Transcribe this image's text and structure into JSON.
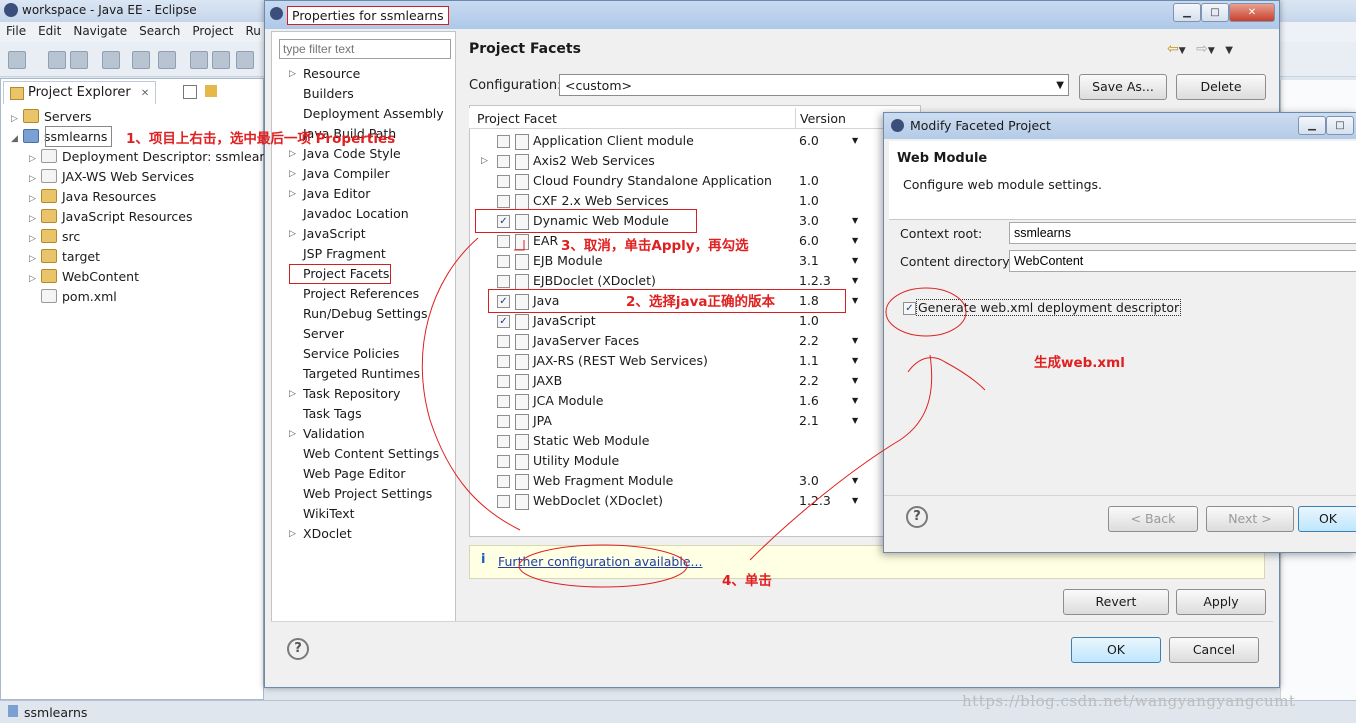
{
  "eclipse": {
    "window_title": "workspace - Java EE - Eclipse",
    "menu": [
      "File",
      "Edit",
      "Navigate",
      "Search",
      "Project",
      "Ru"
    ],
    "explorer_tab": "Project Explorer",
    "tree": [
      {
        "label": "Servers",
        "arrow": "▷",
        "indent": 0,
        "icon": "folder"
      },
      {
        "label": "ssmlearns",
        "arrow": "◢",
        "indent": 0,
        "icon": "project"
      },
      {
        "label": "Deployment Descriptor: ssmlearn",
        "arrow": "▷",
        "indent": 1,
        "icon": "doc"
      },
      {
        "label": "JAX-WS Web Services",
        "arrow": "▷",
        "indent": 1,
        "icon": "doc"
      },
      {
        "label": "Java Resources",
        "arrow": "▷",
        "indent": 1,
        "icon": "folder"
      },
      {
        "label": "JavaScript Resources",
        "arrow": "▷",
        "indent": 1,
        "icon": "folder"
      },
      {
        "label": "src",
        "arrow": "▷",
        "indent": 1,
        "icon": "folder"
      },
      {
        "label": "target",
        "arrow": "▷",
        "indent": 1,
        "icon": "folder"
      },
      {
        "label": "WebContent",
        "arrow": "▷",
        "indent": 1,
        "icon": "folder"
      },
      {
        "label": "pom.xml",
        "arrow": "",
        "indent": 1,
        "icon": "doc"
      }
    ],
    "status": "ssmlearns"
  },
  "properties": {
    "title": "Properties for ssmlearns",
    "filter_placeholder": "type filter text",
    "nav_items": [
      {
        "label": "Resource",
        "arrow": "▷"
      },
      {
        "label": "Builders",
        "arrow": ""
      },
      {
        "label": "Deployment Assembly",
        "arrow": ""
      },
      {
        "label": "Java Build Path",
        "arrow": ""
      },
      {
        "label": "Java Code Style",
        "arrow": "▷"
      },
      {
        "label": "Java Compiler",
        "arrow": "▷"
      },
      {
        "label": "Java Editor",
        "arrow": "▷"
      },
      {
        "label": "Javadoc Location",
        "arrow": ""
      },
      {
        "label": "JavaScript",
        "arrow": "▷"
      },
      {
        "label": "JSP Fragment",
        "arrow": ""
      },
      {
        "label": "Project Facets",
        "arrow": ""
      },
      {
        "label": "Project References",
        "arrow": ""
      },
      {
        "label": "Run/Debug Settings",
        "arrow": ""
      },
      {
        "label": "Server",
        "arrow": ""
      },
      {
        "label": "Service Policies",
        "arrow": ""
      },
      {
        "label": "Targeted Runtimes",
        "arrow": ""
      },
      {
        "label": "Task Repository",
        "arrow": "▷"
      },
      {
        "label": "Task Tags",
        "arrow": ""
      },
      {
        "label": "Validation",
        "arrow": "▷"
      },
      {
        "label": "Web Content Settings",
        "arrow": ""
      },
      {
        "label": "Web Page Editor",
        "arrow": ""
      },
      {
        "label": "Web Project Settings",
        "arrow": ""
      },
      {
        "label": "WikiText",
        "arrow": ""
      },
      {
        "label": "XDoclet",
        "arrow": "▷"
      }
    ],
    "page_title": "Project Facets",
    "configuration_label": "Configuration:",
    "configuration_value": "<custom>",
    "save_as": "Save As...",
    "delete": "Delete",
    "col_facet": "Project Facet",
    "col_version": "Version",
    "facets": [
      {
        "name": "Application Client module",
        "version": "6.0",
        "checked": false,
        "expand": false,
        "dd": true
      },
      {
        "name": "Axis2 Web Services",
        "version": "",
        "checked": false,
        "expand": true,
        "dd": false
      },
      {
        "name": "Cloud Foundry Standalone Application",
        "version": "1.0",
        "checked": false,
        "expand": false,
        "dd": false
      },
      {
        "name": "CXF 2.x Web Services",
        "version": "1.0",
        "checked": false,
        "expand": false,
        "dd": false
      },
      {
        "name": "Dynamic Web Module",
        "version": "3.0",
        "checked": true,
        "expand": false,
        "dd": true
      },
      {
        "name": "EAR",
        "version": "6.0",
        "checked": false,
        "expand": false,
        "dd": true
      },
      {
        "name": "EJB Module",
        "version": "3.1",
        "checked": false,
        "expand": false,
        "dd": true
      },
      {
        "name": "EJBDoclet (XDoclet)",
        "version": "1.2.3",
        "checked": false,
        "expand": false,
        "dd": true
      },
      {
        "name": "Java",
        "version": "1.8",
        "checked": true,
        "expand": false,
        "dd": true
      },
      {
        "name": "JavaScript",
        "version": "1.0",
        "checked": true,
        "expand": false,
        "dd": false
      },
      {
        "name": "JavaServer Faces",
        "version": "2.2",
        "checked": false,
        "expand": false,
        "dd": true
      },
      {
        "name": "JAX-RS (REST Web Services)",
        "version": "1.1",
        "checked": false,
        "expand": false,
        "dd": true
      },
      {
        "name": "JAXB",
        "version": "2.2",
        "checked": false,
        "expand": false,
        "dd": true
      },
      {
        "name": "JCA Module",
        "version": "1.6",
        "checked": false,
        "expand": false,
        "dd": true
      },
      {
        "name": "JPA",
        "version": "2.1",
        "checked": false,
        "expand": false,
        "dd": true
      },
      {
        "name": "Static Web Module",
        "version": "",
        "checked": false,
        "expand": false,
        "dd": false
      },
      {
        "name": "Utility Module",
        "version": "",
        "checked": false,
        "expand": false,
        "dd": false
      },
      {
        "name": "Web Fragment Module",
        "version": "3.0",
        "checked": false,
        "expand": false,
        "dd": true
      },
      {
        "name": "WebDoclet (XDoclet)",
        "version": "1.2.3",
        "checked": false,
        "expand": false,
        "dd": true
      }
    ],
    "info_icon": "i",
    "further_link": "Further configuration available...",
    "revert": "Revert",
    "apply": "Apply",
    "ok": "OK",
    "cancel": "Cancel"
  },
  "modify": {
    "title": "Modify Faceted Project",
    "header_title": "Web Module",
    "header_desc": "Configure web module settings.",
    "context_root_label": "Context root:",
    "context_root_value": "ssmlearns",
    "content_dir_label": "Content directory:",
    "content_dir_value": "WebContent",
    "generate_label": "Generate web.xml deployment descriptor",
    "back": "< Back",
    "next": "Next >",
    "ok": "OK"
  },
  "annotations": {
    "step1": "1、项目上右击，选中最后一项 Properties",
    "step2": "2、选择java正确的版本",
    "step3": "3、取消，单击Apply，再勾选",
    "step4": "4、单击",
    "gen_note": "生成web.xml"
  },
  "watermark": "https://blog.csdn.net/wangyangyangcumt",
  "colors": {
    "annotation": "#e02020",
    "link": "#1f3fa6",
    "accent_border": "#6d8aad"
  }
}
